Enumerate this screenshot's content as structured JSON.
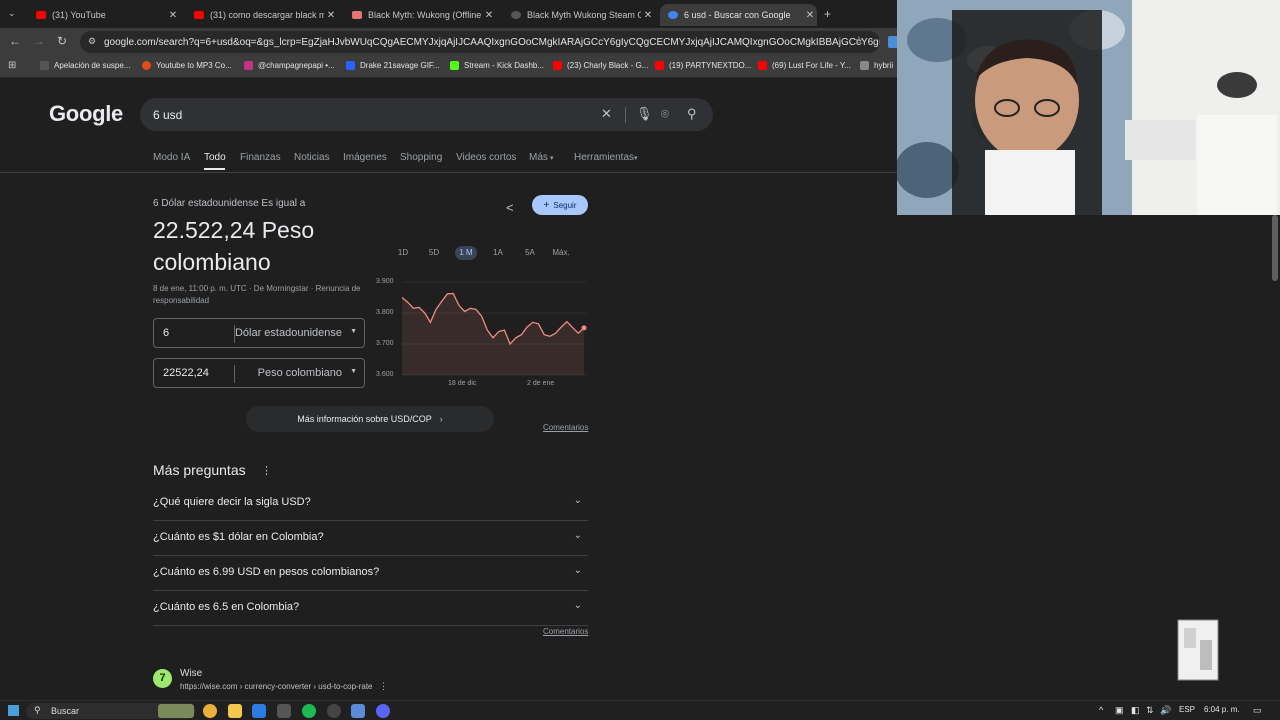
{
  "browser": {
    "tabs": [
      {
        "title": "(31) YouTube",
        "favicon": "youtube-icon",
        "color": "#ff0000"
      },
      {
        "title": "(31) como descargar black myth",
        "favicon": "youtube-icon",
        "color": "#ff0000"
      },
      {
        "title": "Black Myth: Wukong (Offline A",
        "favicon": "page-icon",
        "color": "#e57373"
      },
      {
        "title": "Black Myth Wukong Steam Offl",
        "favicon": "loading-icon",
        "color": "#555555"
      },
      {
        "title": "6 usd - Buscar con Google",
        "favicon": "google-icon",
        "color": "#4285f4",
        "active": true
      }
    ],
    "url": "google.com/search?q=6+usd&oq=&gs_lcrp=EgZjaHJvbWUqCQgAECMYJxjqAjIJCAAQIxgnGOoCMgkIARAjGCcY6gIyCQgCECMYJxjqAjIJCAMQIxgnGOoCMgkIBBAjGCcY6gIyCQgFE...",
    "bookmarks": [
      {
        "label": "Apelación de suspe...",
        "color": "#555555"
      },
      {
        "label": "Youtube to MP3 Co...",
        "color": "#e64a19"
      },
      {
        "label": "@champagnepapi •...",
        "color": "#c13584"
      },
      {
        "label": "Drake 21savage GIF...",
        "color": "#2962ff"
      },
      {
        "label": "Stream - Kick Dashb...",
        "color": "#53fc18"
      },
      {
        "label": "(23) Charly Black - G...",
        "color": "#ff0000"
      },
      {
        "label": "(19) PARTYNEXTDO...",
        "color": "#ff0000"
      },
      {
        "label": "(69) Lust For Life - Y...",
        "color": "#ff0000"
      },
      {
        "label": "hybrii",
        "color": "#888888"
      }
    ]
  },
  "google": {
    "logo": "Google",
    "query": "6 usd",
    "nav_tabs": [
      "Modo IA",
      "Todo",
      "Finanzas",
      "Noticias",
      "Imágenes",
      "Shopping",
      "Videos cortos",
      "Más",
      "Herramientas"
    ],
    "active_tab": "Todo"
  },
  "converter": {
    "equals_label": "6 Dólar estadounidense Es igual a",
    "result": "22.522,24 Peso colombiano",
    "source": "8 de ene, 11:00 p. m. UTC · De Morningstar · Renuncia de responsabilidad",
    "follow_label": "Seguir",
    "from_amount": "6",
    "from_currency": "Dólar estadounidense",
    "to_amount": "22522,24",
    "to_currency": "Peso colombiano",
    "ranges": [
      "1D",
      "5D",
      "1 M",
      "1A",
      "5A",
      "Máx."
    ],
    "active_range": "1 M",
    "more_info": "Más información sobre USD/COP",
    "feedback": "Comentarios"
  },
  "chart_data": {
    "type": "line",
    "series": [
      {
        "values": [
          3850,
          3835,
          3815,
          3818,
          3800,
          3770,
          3812,
          3838,
          3862,
          3863,
          3825,
          3805,
          3815,
          3812,
          3790,
          3745,
          3720,
          3740,
          3745,
          3700,
          3720,
          3730,
          3755,
          3770,
          3765,
          3730,
          3725,
          3735,
          3755,
          3772,
          3753,
          3735,
          3752
        ]
      }
    ],
    "yticks": [
      "3.900",
      "3.800",
      "3.700",
      "3.600"
    ],
    "ylim": [
      3600,
      3900
    ],
    "xticks": [
      "18 de dic",
      "2 de ene"
    ],
    "grid": true,
    "color": "#f28b82"
  },
  "paa": {
    "title": "Más preguntas",
    "questions": [
      "¿Qué quiere decir la sigla USD?",
      "¿Cuánto es $1 dólar en Colombia?",
      "¿Cuánto es 6.99 USD en pesos colombianos?",
      "¿Cuánto es 6.5 en Colombia?"
    ],
    "feedback": "Comentarios"
  },
  "result": {
    "site": "Wise",
    "logo_letter": "7",
    "url": "https://wise.com › currency-converter › usd-to-cop-rate"
  },
  "taskbar": {
    "search_label": "Buscar",
    "language": "ESP",
    "time": "6:04 p. m."
  }
}
